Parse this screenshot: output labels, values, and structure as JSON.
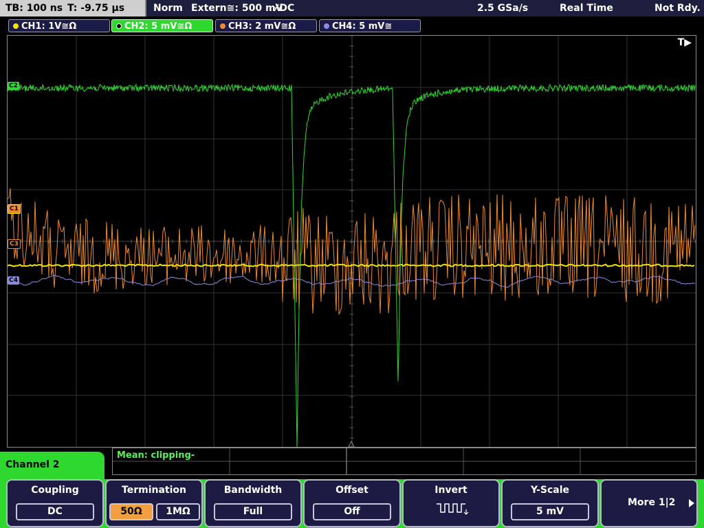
{
  "status_bar": {
    "timebase": "TB: 100 ns",
    "trigger_time": "T: -9.75 µs",
    "trigger_mode": "Norm",
    "trigger_source": "Extern≅: 500 mV",
    "trigger_edge_coupling": "⌿DC",
    "sample_rate": "2.5 GSa/s",
    "acq_mode": "Real Time",
    "run_state": "Not Rdy."
  },
  "channels": [
    {
      "label": "CH1: 1V≅Ω",
      "color": "#f2e600",
      "active": false
    },
    {
      "label": "CH2: 5 mV≅Ω",
      "color": "#2fd82f",
      "active": true
    },
    {
      "label": "CH3: 2 mV≅Ω",
      "color": "#f08a30",
      "active": false
    },
    {
      "label": "CH4: 5 mV≅",
      "color": "#8a8ae6",
      "active": false
    }
  ],
  "screen": {
    "trigger_marker": "T▶",
    "markers": {
      "c1": "C1",
      "c2": "C2",
      "c3": "C3",
      "c4": "C4"
    }
  },
  "measurement": {
    "text": "Mean: clipping-"
  },
  "menu": {
    "title": "Channel 2",
    "coupling": {
      "title": "Coupling",
      "value": "DC"
    },
    "termination": {
      "title": "Termination",
      "opt1": "50Ω",
      "opt2": "1MΩ",
      "selected": "50Ω"
    },
    "bandwidth": {
      "title": "Bandwidth",
      "value": "Full"
    },
    "offset": {
      "title": "Offset",
      "value": "Off"
    },
    "invert": {
      "title": "Invert",
      "icon": "inverted-square-wave-icon"
    },
    "yscale": {
      "title": "Y-Scale",
      "value": "5 mV"
    },
    "more": {
      "label": "More 1|2",
      "icon": "arrow-right-icon"
    }
  }
}
